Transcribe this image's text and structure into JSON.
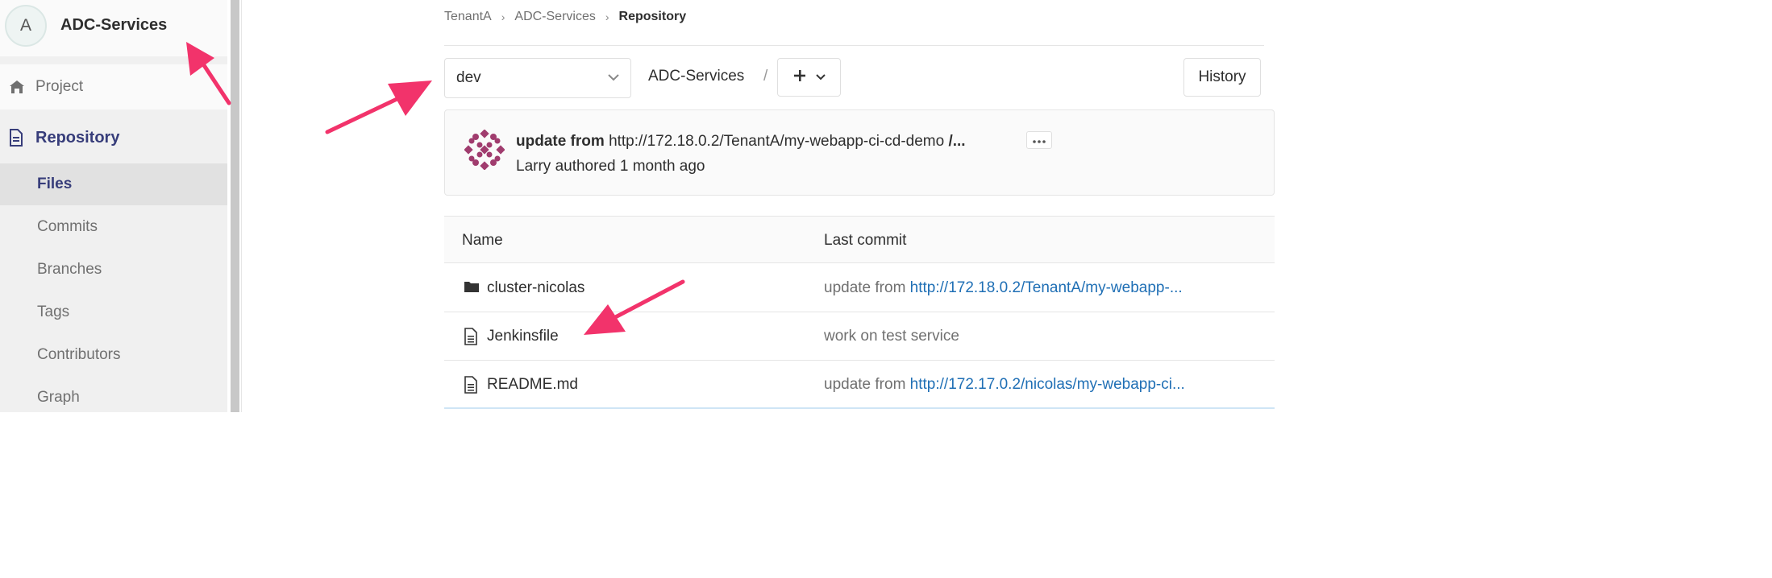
{
  "sidebar": {
    "avatar_letter": "A",
    "project_name": "ADC-Services",
    "project_label": "Project",
    "repository_label": "Repository",
    "sub_items": {
      "files": "Files",
      "commits": "Commits",
      "branches": "Branches",
      "tags": "Tags",
      "contributors": "Contributors",
      "graph": "Graph"
    }
  },
  "breadcrumb": {
    "group": "TenantA",
    "project": "ADC-Services",
    "current": "Repository"
  },
  "tree": {
    "branch": "dev",
    "root": "ADC-Services",
    "slash": "/",
    "history_label": "History"
  },
  "last_commit": {
    "title_bold": "update from",
    "title_link": "http://172.18.0.2/TenantA/my-webapp-ci-cd-demo",
    "title_tail": "/...",
    "meta": "Larry authored 1 month ago"
  },
  "table": {
    "col_name": "Name",
    "col_last_commit": "Last commit",
    "rows": [
      {
        "name": "cluster-nicolas",
        "icon": "folder-icon",
        "msg_prefix": "update from ",
        "msg_link": "http://172.18.0.2/TenantA/my-webapp-..."
      },
      {
        "name": "Jenkinsfile",
        "icon": "file-icon",
        "msg_prefix": "work on test service",
        "msg_link": ""
      },
      {
        "name": "README.md",
        "icon": "file-icon",
        "msg_prefix": "update from ",
        "msg_link": "http://172.17.0.2/nicolas/my-webapp-ci..."
      }
    ]
  },
  "colors": {
    "accent": "#373d7a",
    "link": "#1f6fb5",
    "annotation": "#f2336b",
    "commit_avatar": "#a03c6e"
  }
}
